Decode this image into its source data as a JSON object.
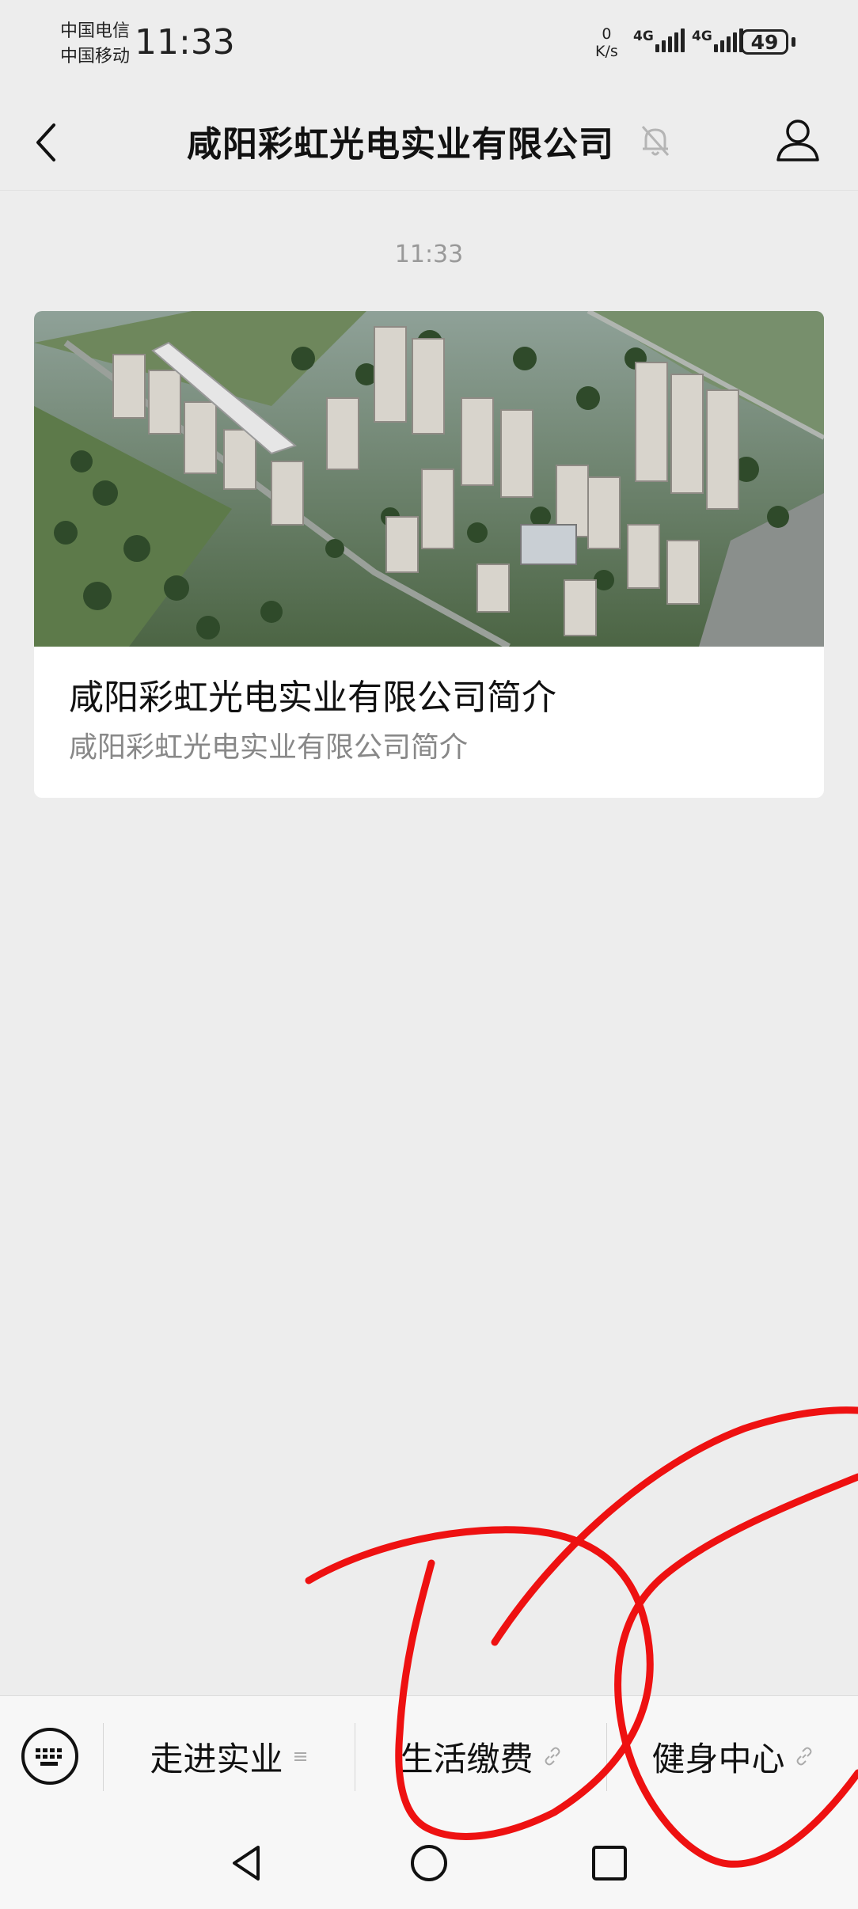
{
  "status_bar": {
    "carrier_1": "中国电信",
    "carrier_2": "中国移动",
    "time": "11:33",
    "net_speed_value": "0",
    "net_speed_unit": "K/s",
    "signal_1_label": "4G",
    "signal_2_label": "4G",
    "battery": "49"
  },
  "nav": {
    "title": "咸阳彩虹光电实业有限公司",
    "back_icon": "chevron-left-icon",
    "mute_icon": "bell-muted-icon",
    "profile_icon": "user-icon"
  },
  "chat": {
    "timestamp": "11:33",
    "article": {
      "title": "咸阳彩虹光电实业有限公司简介",
      "description": "咸阳彩虹光电实业有限公司简介",
      "image": "aerial view of residential complex with high-rise buildings and green trees"
    }
  },
  "menu": {
    "keyboard_icon": "keyboard-icon",
    "items": [
      {
        "label": "走进实业",
        "icon": "menu-lines-icon"
      },
      {
        "label": "生活缴费",
        "icon": "link-icon"
      },
      {
        "label": "健身中心",
        "icon": "link-icon"
      }
    ]
  },
  "system_nav": {
    "back": "triangle-back-icon",
    "home": "circle-home-icon",
    "recents": "square-recents-icon"
  },
  "annotation": {
    "color": "#ee1111"
  }
}
